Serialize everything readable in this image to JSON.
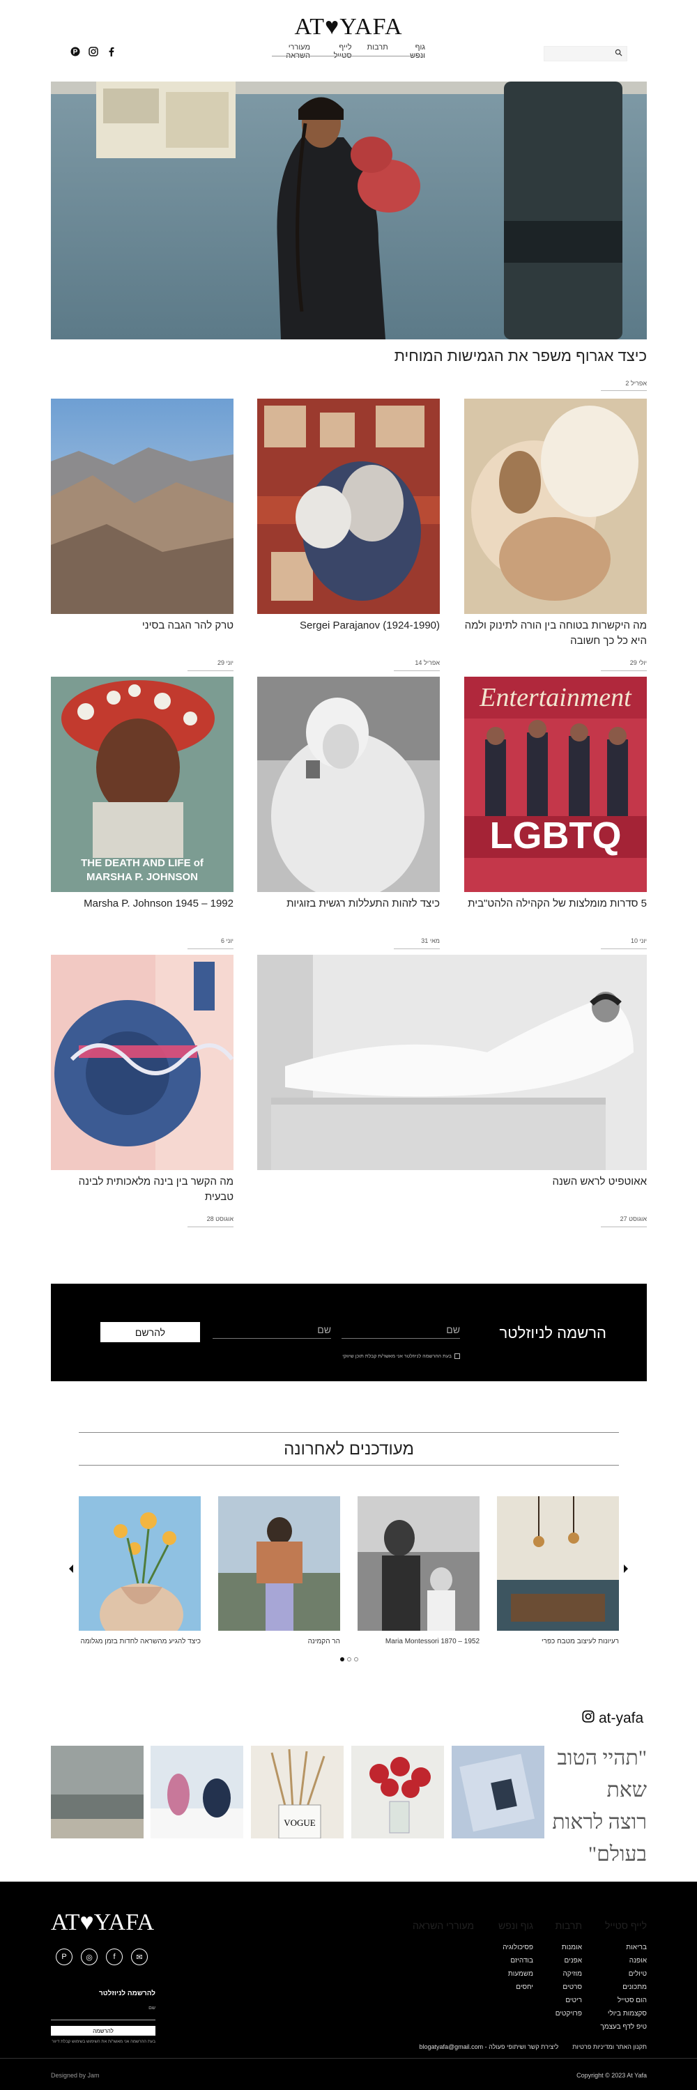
{
  "header": {
    "logo": "AT♥YAFA",
    "nav": [
      "גוף ונפש",
      "תרבות",
      "לייף סטייל",
      "מעוררי השראה"
    ],
    "search_icon": "search-icon",
    "social": [
      "pinterest-icon",
      "instagram-icon",
      "facebook-icon"
    ]
  },
  "hero": {
    "title": "כיצד אגרוף משפר את הגמישות המוחית",
    "date": "אפריל 2"
  },
  "posts": [
    {
      "title": "מה היקשרות בטוחה בין הורה לתינוק ולמה היא כל כך חשובה",
      "date": "יולי 29"
    },
    {
      "title": "Sergei Parajanov (1924-1990)",
      "date": "אפריל 14"
    },
    {
      "title": "טרק להר הגבה בסיני",
      "date": "יוני 29"
    },
    {
      "title": "5 סדרות מומלצות של הקהילה הלהט\"בית",
      "date": "יוני 10"
    },
    {
      "title": "כיצד לזהות התעללות רגשית בזוגיות",
      "date": "מאי 31"
    },
    {
      "title": "Marsha P. Johnson 1945 – 1992",
      "date": "יוני 6"
    },
    {
      "title": "אאוטפיט לראש השנה",
      "date": "אוגוסט 27"
    },
    {
      "title": "מה הקשר בין בינה מלאכותית לבינה טבעית",
      "date": "אוגוסט 28"
    }
  ],
  "newsletter": {
    "heading": "הרשמה לניוזלטר",
    "name_placeholder": "שם",
    "surname_placeholder": "שם",
    "button": "להרשם",
    "consent": "בעת ההרשמה לניוזלטר אני מאשר/ת קבלת תוכן שיווקי"
  },
  "recent": {
    "title": "מעודכנים לאחרונה",
    "items": [
      {
        "caption": "רעיונות לעיצוב מטבח כפרי"
      },
      {
        "caption": "Maria Montessori 1870 – 1952"
      },
      {
        "caption": "הר הקמינה"
      },
      {
        "caption": "כיצד להגיע מהשראה לחדות בזמן מגלומה"
      }
    ]
  },
  "instagram": {
    "handle": "at-yafa",
    "quote": [
      "\"תהיי הטוב שאת",
      "רוצה לראות",
      "בעולם\""
    ]
  },
  "footer": {
    "logo": "AT♥YAFA",
    "columns": [
      {
        "head": "לייף סטייל",
        "items": [
          "בריאות",
          "אופנה",
          "טיולים",
          "מתכונים",
          "הום סטייל",
          "סקצמות ביולי",
          "טיפ לדף בעצמך"
        ]
      },
      {
        "head": "תרבות",
        "items": [
          "אומנות",
          "אפנים",
          "מוזיקה",
          "סרטים",
          "ריטים",
          "פרויקטים"
        ]
      },
      {
        "head": "גוף ונפש",
        "items": [
          "פסיכולוגיה",
          "בודהיזם",
          "משמעות",
          "יחסים"
        ]
      },
      {
        "head": "מעוררי השראה",
        "items": []
      }
    ],
    "newsletter_title": "להרשמה לניוזלטר",
    "newsletter_label": "שם",
    "newsletter_button": "להרשמה",
    "newsletter_consent": "בעת ההרשמה אני מאשר/ת את השימוש בשימוש קבלת דיוור",
    "links_right": "תקנון האתר ומדיניות פרטיות",
    "links_mid": "ליצירת קשר ושיתופי פעולה - blogatyafa@gmail.com",
    "copyright": "Copyright © 2023 At Yafa",
    "designed": "Designed by Jam"
  }
}
